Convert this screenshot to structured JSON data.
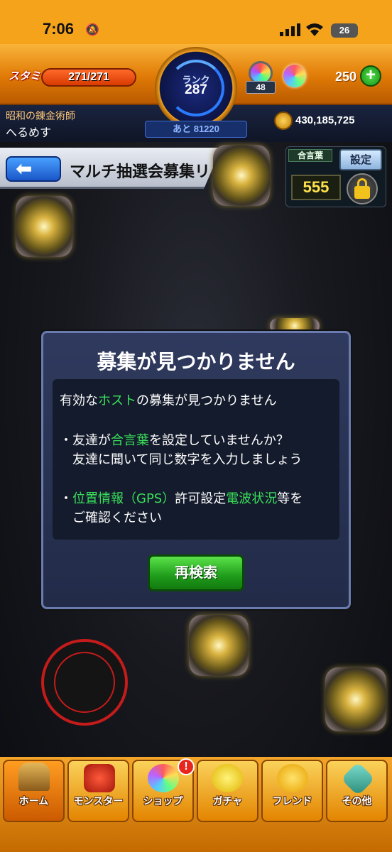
{
  "status_bar": {
    "time": "7:06",
    "battery": "26"
  },
  "header": {
    "stamina_label": "スタミナ",
    "stamina_value": "271/271",
    "rank_label": "ランク",
    "rank_value": "287",
    "next_rank": "あと 81220",
    "orb_count": "48",
    "gems": "250",
    "player_title": "昭和の錬金術師",
    "player_name": "へるめす",
    "coins": "430,185,725"
  },
  "screen": {
    "title": "マルチ抽選会募集リスト",
    "passphrase_label": "合言葉",
    "settings_button": "設定",
    "passphrase_value": "555"
  },
  "dialog": {
    "title": "募集が見つかりません",
    "line1_a": "有効な",
    "line1_b": "ホスト",
    "line1_c": "の募集が見つかりません",
    "bullet1_a": "・友達が",
    "bullet1_b": "合言葉",
    "bullet1_c": "を設定していませんか？",
    "bullet1_line2": "友達に聞いて同じ数字を入力しましょう",
    "bullet2_a": "・",
    "bullet2_b": "位置情報（GPS）",
    "bullet2_c": "許可設定",
    "bullet2_d": "電波状況",
    "bullet2_e": "等を",
    "bullet2_line2": "ご確認ください",
    "button": "再検索"
  },
  "nav": {
    "items": [
      {
        "label": "ホーム"
      },
      {
        "label": "モンスター"
      },
      {
        "label": "ショップ"
      },
      {
        "label": "ガチャ"
      },
      {
        "label": "フレンド"
      },
      {
        "label": "その他"
      }
    ],
    "shop_badge": "!"
  },
  "colors": {
    "accent": "#f6a31c",
    "highlight": "#39e05a",
    "dialog": "#2f3a5e"
  }
}
